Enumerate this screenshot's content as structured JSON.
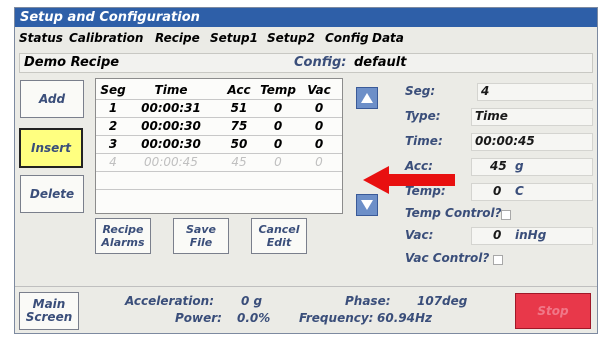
{
  "window": {
    "title": "Setup and Configuration"
  },
  "menu": {
    "items": [
      "Status",
      "Calibration",
      "Recipe",
      "Setup1",
      "Setup2",
      "Config",
      "Data"
    ]
  },
  "recipe_bar": {
    "name": "Demo Recipe",
    "config_label": "Config:",
    "config_value": "default"
  },
  "side_buttons": {
    "add": "Add",
    "insert": "Insert",
    "delete": "Delete"
  },
  "table": {
    "headers": [
      "Seg",
      "Time",
      "Acc",
      "Temp",
      "Vac"
    ],
    "rows": [
      [
        "1",
        "00:00:31",
        "51",
        "0",
        "0"
      ],
      [
        "2",
        "00:00:30",
        "75",
        "0",
        "0"
      ],
      [
        "3",
        "00:00:30",
        "50",
        "0",
        "0"
      ],
      [
        "4",
        "00:00:45",
        "45",
        "0",
        "0"
      ]
    ]
  },
  "bottom_buttons": {
    "recipe_alarms_1": "Recipe",
    "recipe_alarms_2": "Alarms",
    "save_file_1": "Save",
    "save_file_2": "File",
    "cancel_edit_1": "Cancel",
    "cancel_edit_2": "Edit"
  },
  "segment_panel": {
    "seg_label": "Seg:",
    "seg_value": "4",
    "type_label": "Type:",
    "type_value": "Time",
    "time_label": "Time:",
    "time_value": "00:00:45",
    "acc_label": "Acc:",
    "acc_value": "45",
    "acc_unit": "g",
    "temp_label": "Temp:",
    "temp_value": "0",
    "temp_unit": "C",
    "temp_control_label": "Temp Control?",
    "vac_label": "Vac:",
    "vac_value": "0",
    "vac_unit": "inHg",
    "vac_control_label": "Vac Control?"
  },
  "status_bar": {
    "main_screen_1": "Main",
    "main_screen_2": "Screen",
    "acceleration_label": "Acceleration:",
    "acceleration_value": "0 g",
    "power_label": "Power:",
    "power_value": "0.0%",
    "phase_label": "Phase:",
    "phase_value": "107deg",
    "frequency_label": "Frequency:",
    "frequency_value": "60.94Hz",
    "stop_label": "Stop"
  },
  "colors": {
    "titlebar": "#2e5fa8",
    "insert_highlight": "#ffff80",
    "stop_button": "#e8384a",
    "arrow": "#e81010"
  },
  "annotation": {
    "arrow_icon": "red-left-arrow"
  }
}
